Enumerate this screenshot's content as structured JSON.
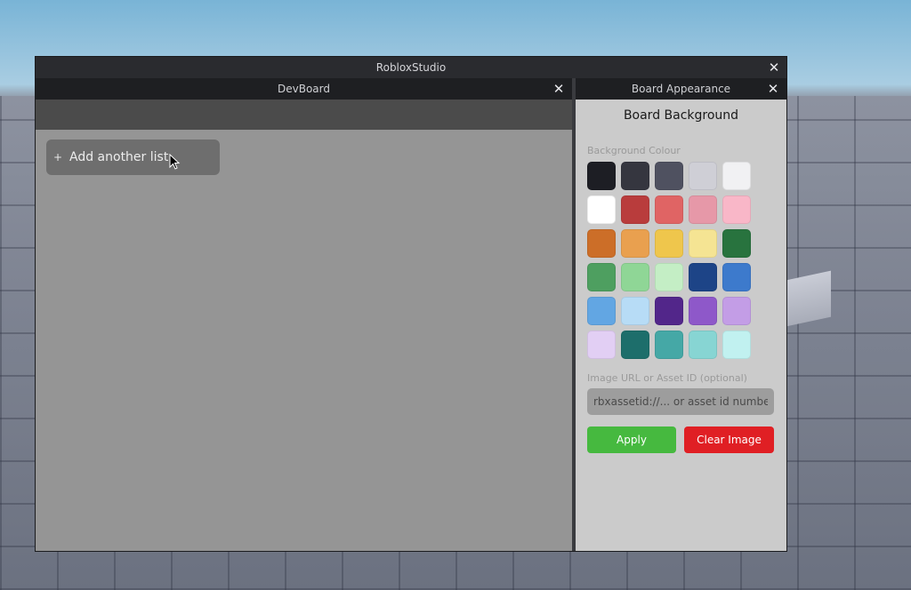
{
  "window": {
    "title": "RobloxStudio"
  },
  "devboard": {
    "title": "DevBoard",
    "add_list_label": "Add another list",
    "add_icon": "+"
  },
  "appearance": {
    "title": "Board Appearance",
    "section_title": "Board Background",
    "colour_label": "Background Colour",
    "swatches": [
      "#1d1e24",
      "#35363f",
      "#4f5160",
      "#cfcfd6",
      "#f1f1f3",
      "#ffffff",
      "#b93c3c",
      "#e06464",
      "#e698a8",
      "#f9b7c8",
      "#cc6e28",
      "#e9a04f",
      "#efc64c",
      "#f5e493",
      "#28733e",
      "#4e9f60",
      "#8fd696",
      "#c4eec5",
      "#1d4487",
      "#3d7acc",
      "#62a6e3",
      "#b7dcf6",
      "#52268a",
      "#8e58c9",
      "#c39de6",
      "#e2cff4",
      "#1d6e6b",
      "#45a8a6",
      "#87d5d3",
      "#c1f1f0"
    ],
    "image_label": "Image URL or Asset ID (optional)",
    "image_placeholder": "rbxassetid://... or asset id number",
    "apply_label": "Apply",
    "clear_label": "Clear Image",
    "apply_color": "#46b93f",
    "clear_color": "#e01f24"
  },
  "icons": {
    "close": "close-icon",
    "cursor": "mouse-cursor-icon"
  }
}
